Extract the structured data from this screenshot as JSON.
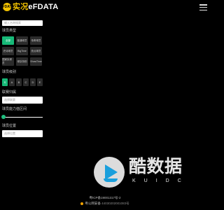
{
  "header": {
    "badge_text": "EFDATA",
    "logo_cn": "实况",
    "logo_en": "eFDATA",
    "menu_icon": "hamburger-menu-icon"
  },
  "form": {
    "search_placeholder": "输入名称搜索",
    "mode_label": "球员类型",
    "chips": [
      {
        "label": "全部",
        "active": true
      },
      {
        "label": "普通球员"
      },
      {
        "label": "传奇球员"
      },
      {
        "label": "史诗球员"
      },
      {
        "label": "BigTime"
      },
      {
        "label": "亮点球员"
      },
      {
        "label": "国家队球员"
      },
      {
        "label": "球队特别"
      },
      {
        "label": "ShowTime"
      }
    ],
    "rarity_label": "球员级别",
    "letters": [
      "S",
      "A",
      "B",
      "C",
      "D",
      "E"
    ],
    "active_letter": "S",
    "league_label": "联赛归属",
    "league_placeholder": "选择联赛",
    "slider_label": "球员能力值区间",
    "slider_value": 0,
    "position_label": "球员位置",
    "position_placeholder": "选择位置"
  },
  "watermark": {
    "big": "酷数据",
    "sub": "KUIDC"
  },
  "footer": {
    "icp": "粤ICP备19001317号-2",
    "police": "粤公网安备",
    "police_no": "44030202001083号"
  },
  "colors": {
    "accent": "#17b978",
    "brand": "#f2c200",
    "background": "#000000"
  }
}
